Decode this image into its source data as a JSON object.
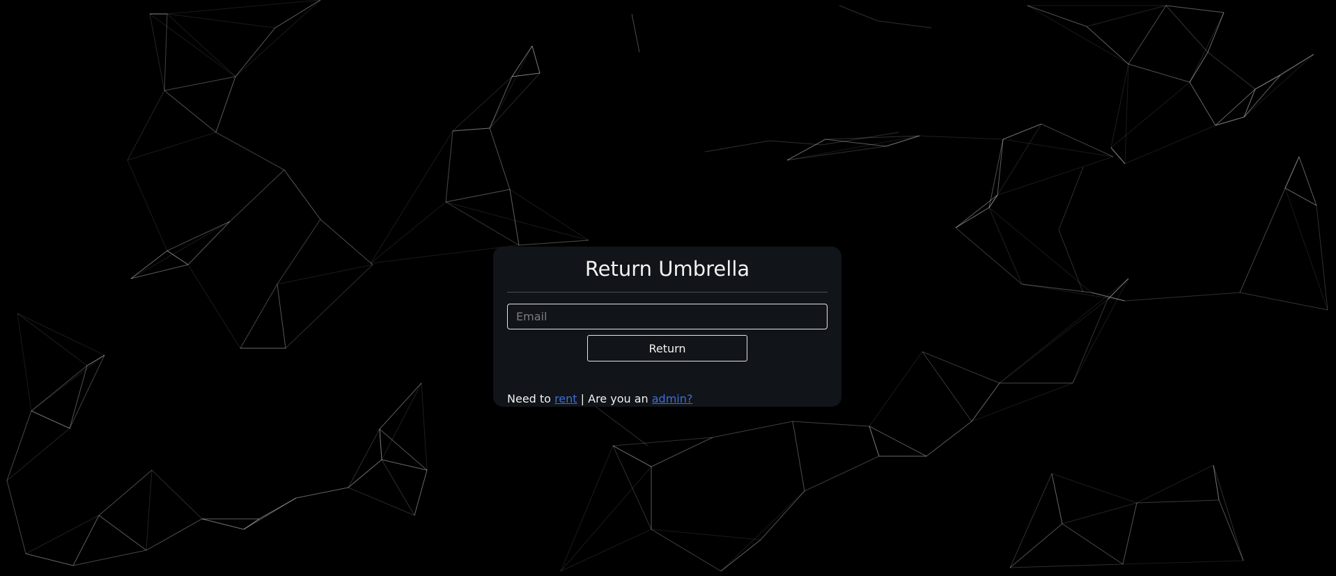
{
  "card": {
    "title": "Return Umbrella",
    "email_placeholder": "Email",
    "email_value": "",
    "return_label": "Return",
    "footer": {
      "prefix": "Need to",
      "rent_link": "rent",
      "middle": "| Are you an",
      "admin_link": "admin?"
    }
  },
  "colors": {
    "background": "#000000",
    "card": "#111418",
    "link": "#3b6fe0",
    "network_lines": "#3a3a3a"
  }
}
